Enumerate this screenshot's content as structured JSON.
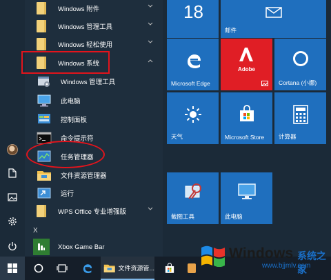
{
  "app_list": {
    "items": [
      {
        "label": "Windows 附件",
        "icon": "folder-icon"
      },
      {
        "label": "Windows 管理工具",
        "icon": "folder-icon"
      },
      {
        "label": "Windows 轻松使用",
        "icon": "folder-icon"
      },
      {
        "label": "Windows 系统",
        "icon": "folder-icon",
        "expanded": true
      }
    ],
    "sub_items": [
      {
        "label": "Windows 管理工具",
        "icon": "admin-tools-icon"
      },
      {
        "label": "此电脑",
        "icon": "this-pc-icon"
      },
      {
        "label": "控制面板",
        "icon": "control-panel-icon"
      },
      {
        "label": "命令提示符",
        "icon": "command-prompt-icon"
      },
      {
        "label": "任务管理器",
        "icon": "task-manager-icon"
      },
      {
        "label": "文件资源管理器",
        "icon": "file-explorer-icon"
      },
      {
        "label": "运行",
        "icon": "run-icon"
      }
    ],
    "wps": {
      "label": "WPS Office 专业增强版"
    },
    "section_letter": "X",
    "xbox": {
      "label": "Xbox Game Bar"
    }
  },
  "tiles": {
    "calendar": {
      "date": "18",
      "label": ""
    },
    "mail": {
      "label": "邮件"
    },
    "edge": {
      "label": "Microsoft Edge"
    },
    "adobe": {
      "label": "Adobe"
    },
    "cortana": {
      "label": "Cortana (小娜)"
    },
    "weather": {
      "label": "天气"
    },
    "store": {
      "label": "Microsoft Store"
    },
    "calculator": {
      "label": "计算器"
    },
    "snipping": {
      "label": "截图工具"
    },
    "thispc": {
      "label": "此电脑"
    }
  },
  "taskbar": {
    "explorer_label": "文件资源管..."
  },
  "watermark": {
    "title": "Windows",
    "cn": "系统之家",
    "url": "www.bjjmlv.com"
  },
  "colors": {
    "tile_blue": "#1f6fbe",
    "adobe_red": "#e01e25",
    "annotation_red": "#e3141c",
    "folder_yellow": "#f2d17a"
  }
}
